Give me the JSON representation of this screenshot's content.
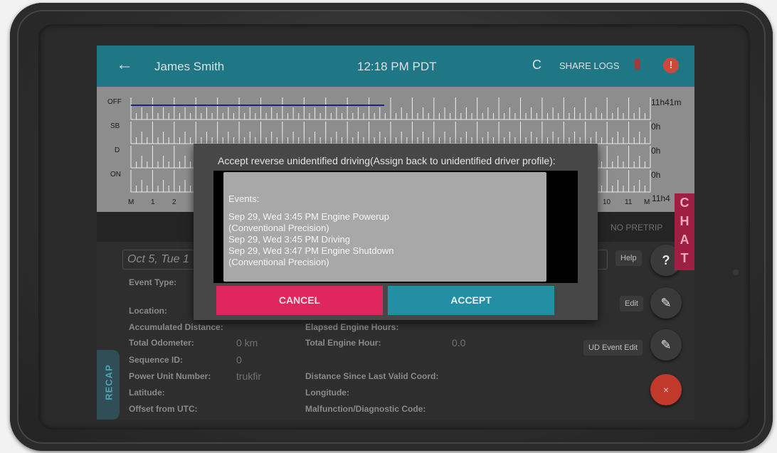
{
  "appbar": {
    "title": "James Smith",
    "time": "12:18 PM PDT",
    "share_label": "SHARE LOGS",
    "back_icon": "←",
    "refresh_icon": "C",
    "alert_icon": "!"
  },
  "graph": {
    "rows": [
      "OFF",
      "SB",
      "D",
      "ON"
    ],
    "totals": [
      "11h41m",
      "0h",
      "0h",
      "0h"
    ],
    "total_summary": "11h4",
    "hour_labels": [
      "M",
      "1",
      "2",
      "10",
      "11",
      "M"
    ]
  },
  "strip": {
    "status": "NO PRETRIP"
  },
  "panel": {
    "date": "Oct 5, Tue 1",
    "help_label": "Help",
    "edit_label": "Edit",
    "ud_edit_label": "UD Event Edit",
    "fields": {
      "event_type_label": "Event Type:",
      "location_label": "Location:",
      "accumulated_distance_label": "Accumulated Distance:",
      "elapsed_engine_hours_label": "Elapsed Engine Hours:",
      "total_odometer_label": "Total Odometer:",
      "total_odometer_value": "0 km",
      "total_engine_hour_label": "Total Engine Hour:",
      "total_engine_hour_value": "0.0",
      "sequence_id_label": "Sequence ID:",
      "sequence_id_value": "0",
      "power_unit_label": "Power Unit Number:",
      "power_unit_value": "trukfir",
      "distance_since_label": "Distance Since Last Valid Coord:",
      "latitude_label": "Latitude:",
      "longitude_label": "Longitude:",
      "offset_label": "Offset from UTC:",
      "malfunction_label": "Malfunction/Diagnostic Code:"
    }
  },
  "recap_label": "RECAP",
  "chat_letters": [
    "C",
    "H",
    "A",
    "T"
  ],
  "dialog": {
    "title": "Accept reverse unidentified driving(Assign back to unidentified driver profile):",
    "events_heading": "Events:",
    "events_lines": [
      "Sep 29, Wed 3:45 PM Engine Powerup",
      "(Conventional Precision)",
      "Sep 29, Wed 3:45 PM Driving",
      "Sep 29, Wed 3:47 PM Engine Shutdown",
      "(Conventional Precision)"
    ],
    "cancel_label": "CANCEL",
    "accept_label": "ACCEPT"
  },
  "colors": {
    "appbar": "#1f7685",
    "cancel": "#e0265e",
    "accept": "#248fa4",
    "chat": "#9f1f43",
    "duty_line": "#1a237e"
  }
}
